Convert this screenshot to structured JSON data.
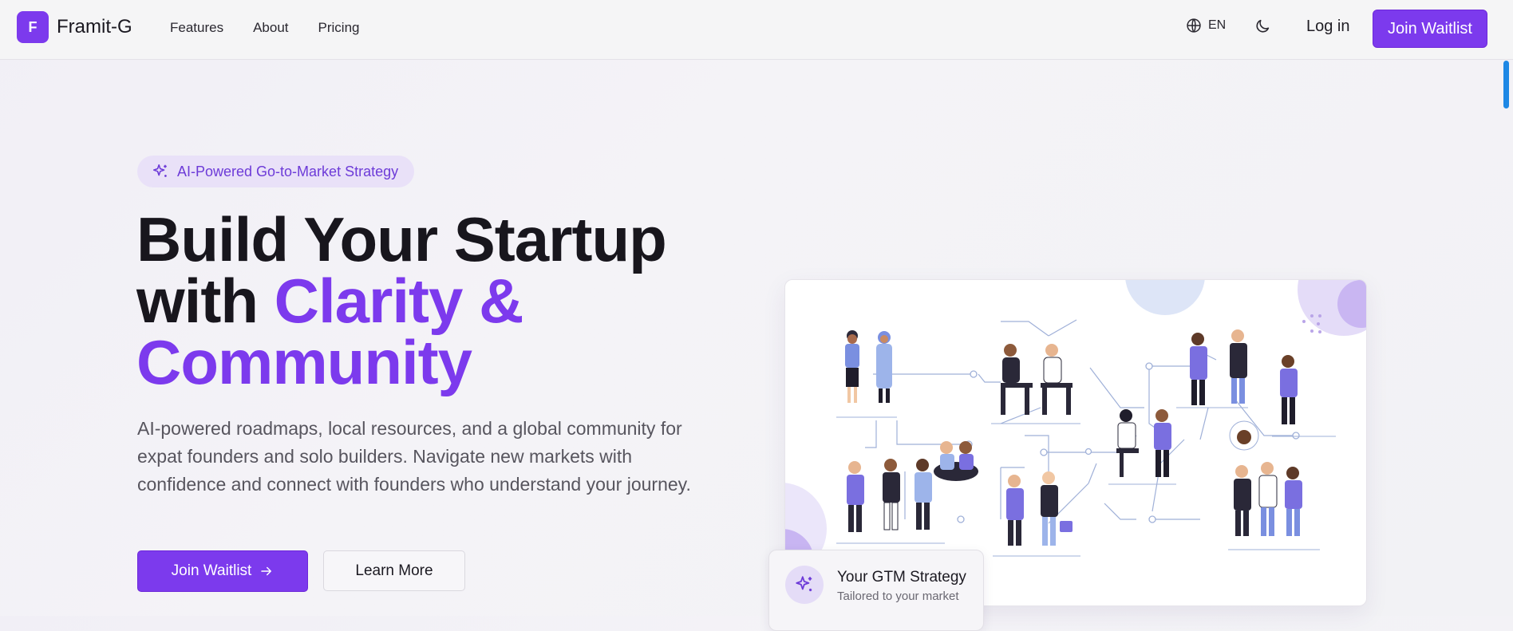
{
  "brand": {
    "logo_letter": "F",
    "name": "Framit-G",
    "accent_color": "#7c3aed"
  },
  "nav": {
    "links": [
      {
        "label": "Features"
      },
      {
        "label": "About"
      },
      {
        "label": "Pricing"
      }
    ],
    "language": "EN",
    "language_icon": "globe-icon",
    "theme_icon": "moon-icon",
    "login_label": "Log in",
    "cta_label": "Join Waitlist"
  },
  "hero": {
    "badge": {
      "icon": "sparkles-icon",
      "label": "AI-Powered Go-to-Market Strategy"
    },
    "headline": {
      "line1": "Build Your Startup",
      "line2_prefix": "with ",
      "line2_accent": "Clarity &",
      "line3_accent": "Community"
    },
    "description": "AI-powered roadmaps, local resources, and a global community for expat founders and solo builders. Navigate new markets with confidence and connect with founders who understand your journey.",
    "primary_cta": {
      "label": "Join Waitlist",
      "icon": "arrow-right-icon"
    },
    "secondary_cta": {
      "label": "Learn More"
    }
  },
  "illustration": {
    "description_icon": "community-network-illustration"
  },
  "floating_card": {
    "icon": "sparkles-icon",
    "title": "Your GTM Strategy",
    "subtitle": "Tailored to your market"
  }
}
